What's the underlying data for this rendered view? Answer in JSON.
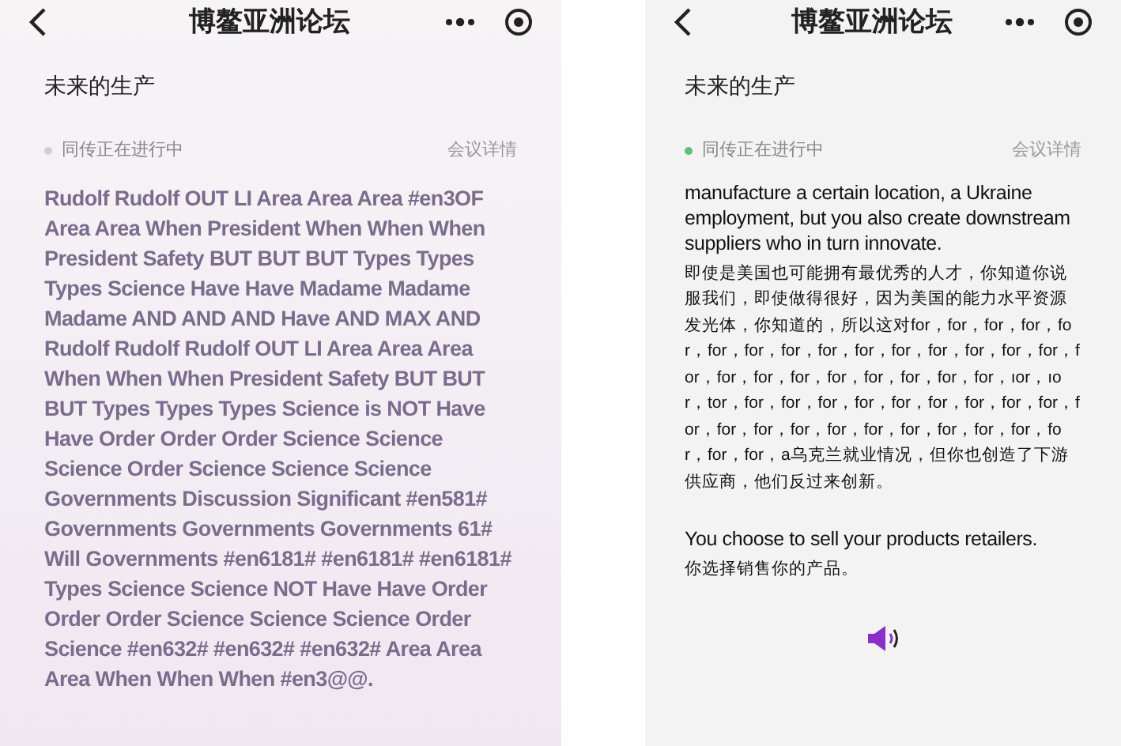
{
  "screens": [
    {
      "kind": "glitched",
      "title": "博鳌亚洲论坛",
      "topic": "未来的生产",
      "status": {
        "text": "同传正在进行中",
        "color": "#cfcfd4"
      },
      "details_link": "会议详情",
      "paragraphs": [
        {
          "kind": "english",
          "text": "Rudolf Rudolf OUT LI Area Area Area #en3OF Area Area When President When When When President Safety BUT BUT BUT Types Types Types Science Have Have Madame Madame Madame AND AND AND Have AND MAX AND Rudolf Rudolf Rudolf OUT LI Area Area Area When When When President Safety BUT BUT BUT Types Types Types Science is NOT Have Have Order Order Order Science Science Science Order Science Science Science Governments Discussion Significant #en581# Governments Governments Governments 61# Will Governments #en6181# #en6181# #en6181# Types Science Science NOT Have Have Order Order Order Science Science Science Order Science #en632# #en632# #en632# Area Area Area When When When #en3@@."
        }
      ]
    },
    {
      "kind": "normal",
      "title": "博鳌亚洲论坛",
      "topic": "未来的生产",
      "status": {
        "text": "同传正在进行中",
        "color": "#5fbf7a"
      },
      "details_link": "会议详情",
      "paragraphs": [
        {
          "kind": "english",
          "text": "manufacture a certain location, a Ukraine employment, but you also create downstream suppliers who in turn innovate."
        },
        {
          "kind": "chinese",
          "text": "即使是美国也可能拥有最优秀的人才，你知道你说服我们，即使做得很好，因为美国的能力水平资源发光体，你知道的，所以这对for，for，for，for，for，for，for，for，for，for，for，for，for，for，for，for，for，for，for，for，for，for，for，for，ıor，ıor，tor，for，for，for，for，for，for，for，for，for，for，for，for，for，for，for，for，for，for，for，for，for，for，a乌克兰就业情况，但你也创造了下游供应商，他们反过来创新。"
        },
        {
          "kind": "english",
          "text": "You choose to sell your products retailers."
        },
        {
          "kind": "chinese",
          "text": "你选择销售你的产品。"
        }
      ],
      "audio_button": true
    }
  ]
}
